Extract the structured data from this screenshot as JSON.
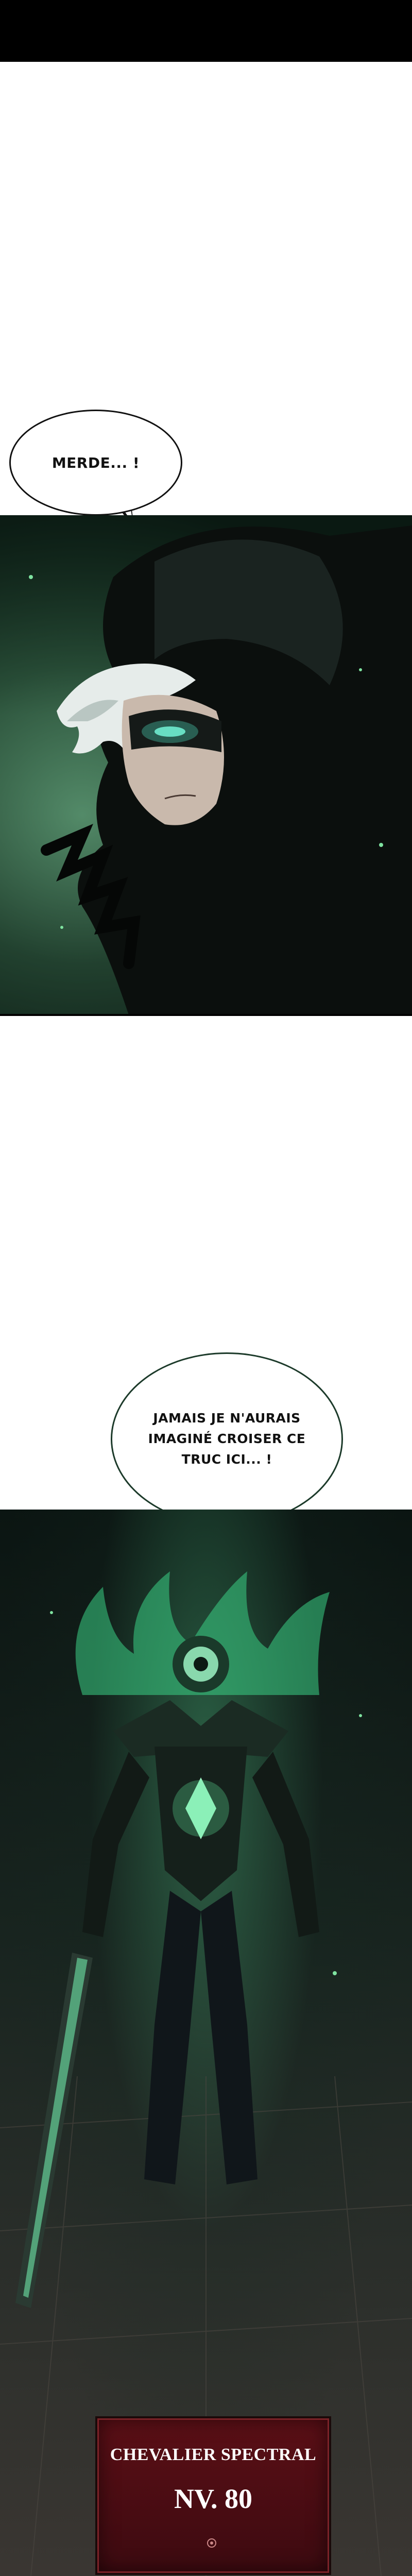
{
  "panels": {
    "bubble1": "MERDE... !",
    "bubble2_lines": [
      "JAMAIS JE N'AURAIS",
      "IMAGINÉ CROISER CE",
      "TRUC ICI... !"
    ]
  },
  "card": {
    "name": "CHEVALIER SPECTRAL",
    "level": "NV. 80"
  },
  "colors": {
    "card_bg": "#5b0f16",
    "glow_green": "#5fe39a",
    "panel_dark": "#0d1a14"
  }
}
